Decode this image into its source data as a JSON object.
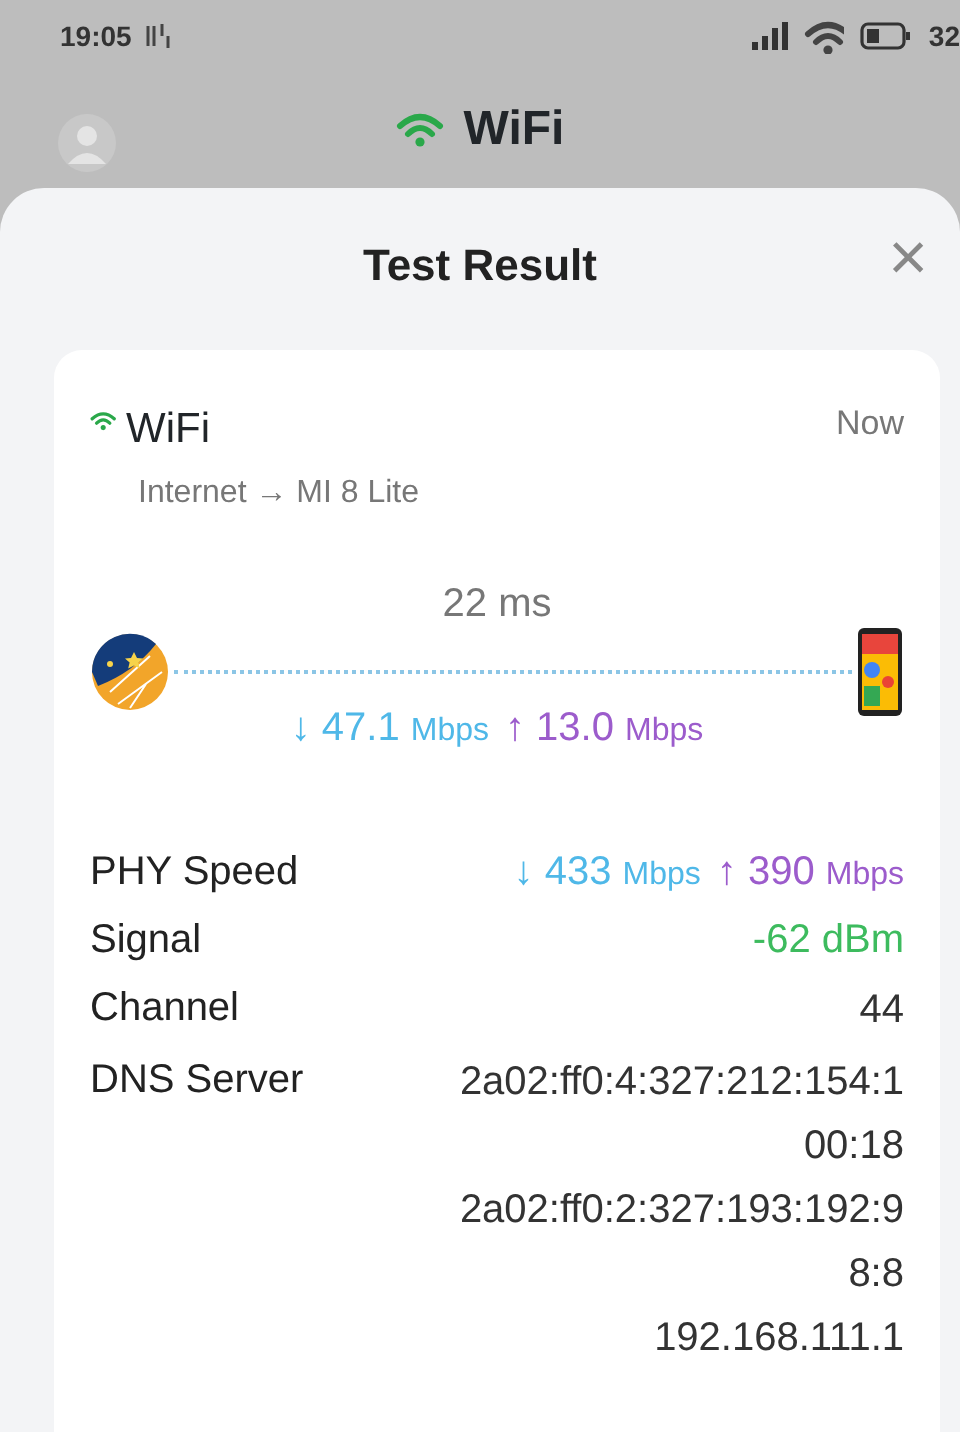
{
  "status_bar": {
    "time": "19:05",
    "battery": "32"
  },
  "header": {
    "title": "WiFi"
  },
  "sheet": {
    "title": "Test Result",
    "close": "×"
  },
  "result": {
    "network": "WiFi",
    "time": "Now",
    "route": "Internet → MI 8 Lite",
    "latency": "22 ms",
    "download": {
      "arrow": "↓",
      "value": "47.1",
      "unit": "Mbps"
    },
    "upload": {
      "arrow": "↑",
      "value": "13.0",
      "unit": "Mbps"
    }
  },
  "details": [
    {
      "kind": "speed",
      "label": "PHY Speed",
      "download": {
        "arrow": "↓",
        "value": "433",
        "unit": "Mbps"
      },
      "upload": {
        "arrow": "↑",
        "value": "390",
        "unit": "Mbps"
      }
    },
    {
      "kind": "signal",
      "label": "Signal",
      "value": "-62 dBm"
    },
    {
      "kind": "text",
      "label": "Channel",
      "lines": [
        "44"
      ]
    },
    {
      "kind": "text",
      "label": "DNS Server",
      "lines": [
        "2a02:ff0:4:327:212:154:1",
        "00:18",
        "2a02:ff0:2:327:193:192:9",
        "8:8",
        "192.168.111.1"
      ]
    }
  ]
}
